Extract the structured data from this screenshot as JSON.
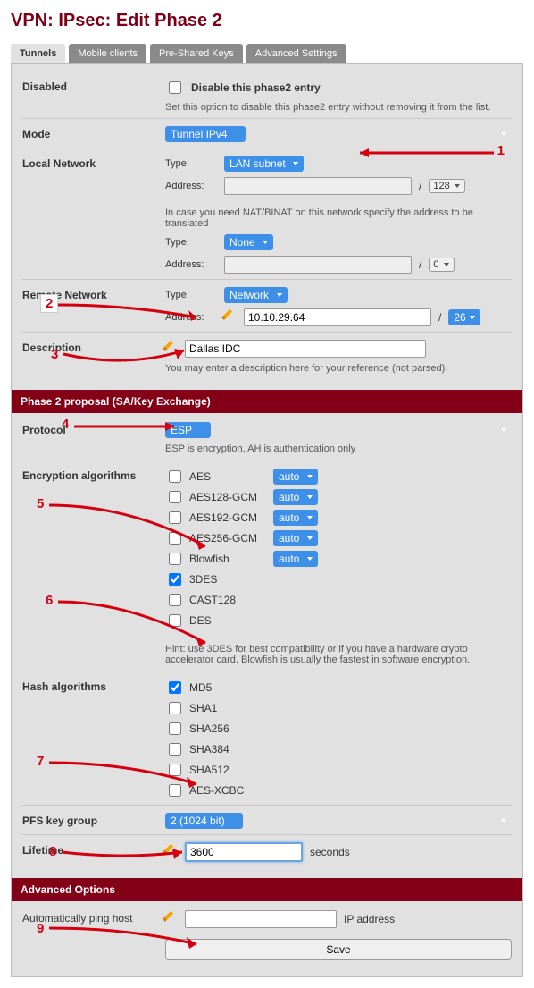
{
  "title": "VPN: IPsec: Edit Phase 2",
  "tabs": [
    "Tunnels",
    "Mobile clients",
    "Pre-Shared Keys",
    "Advanced Settings"
  ],
  "disabled": {
    "label": "Disabled",
    "checkbox_label": "Disable this phase2 entry",
    "help": "Set this option to disable this phase2 entry without removing it from the list."
  },
  "mode": {
    "label": "Mode",
    "value": "Tunnel IPv4"
  },
  "local": {
    "label": "Local Network",
    "type_label": "Type:",
    "type_value": "LAN subnet",
    "addr_label": "Address:",
    "addr_value": "",
    "cidr": "128",
    "nat_hint": "In case you need NAT/BINAT on this network specify the address to be translated",
    "nat_type_label": "Type:",
    "nat_type_value": "None",
    "nat_addr_label": "Address:",
    "nat_addr_value": "",
    "nat_cidr": "0"
  },
  "remote": {
    "label": "Remote Network",
    "type_label": "Type:",
    "type_value": "Network",
    "addr_label": "Address:",
    "addr_value": "10.10.29.64",
    "cidr": "26"
  },
  "description": {
    "label": "Description",
    "value": "Dallas IDC",
    "help": "You may enter a description here for your reference (not parsed)."
  },
  "bar1": "Phase 2 proposal (SA/Key Exchange)",
  "protocol": {
    "label": "Protocol",
    "value": "ESP",
    "help": "ESP is encryption, AH is authentication only"
  },
  "enc": {
    "label": "Encryption algorithms",
    "algos": [
      {
        "name": "AES",
        "checked": false,
        "select": "auto"
      },
      {
        "name": "AES128-GCM",
        "checked": false,
        "select": "auto"
      },
      {
        "name": "AES192-GCM",
        "checked": false,
        "select": "auto"
      },
      {
        "name": "AES256-GCM",
        "checked": false,
        "select": "auto"
      },
      {
        "name": "Blowfish",
        "checked": false,
        "select": "auto"
      },
      {
        "name": "3DES",
        "checked": true
      },
      {
        "name": "CAST128",
        "checked": false
      },
      {
        "name": "DES",
        "checked": false
      }
    ],
    "hint": "Hint: use 3DES for best compatibility or if you have a hardware crypto accelerator card. Blowfish is usually the fastest in software encryption."
  },
  "hash": {
    "label": "Hash algorithms",
    "algos": [
      {
        "name": "MD5",
        "checked": true
      },
      {
        "name": "SHA1",
        "checked": false
      },
      {
        "name": "SHA256",
        "checked": false
      },
      {
        "name": "SHA384",
        "checked": false
      },
      {
        "name": "SHA512",
        "checked": false
      },
      {
        "name": "AES-XCBC",
        "checked": false
      }
    ]
  },
  "pfs": {
    "label": "PFS key group",
    "value": "2 (1024 bit)"
  },
  "lifetime": {
    "label": "Lifetime",
    "value": "3600",
    "unit": "seconds"
  },
  "bar2": "Advanced Options",
  "ping": {
    "label": "Automatically ping host",
    "value": "",
    "unit": "IP address"
  },
  "save": "Save",
  "annotations": [
    "1",
    "2",
    "3",
    "4",
    "5",
    "6",
    "7",
    "8",
    "9"
  ]
}
